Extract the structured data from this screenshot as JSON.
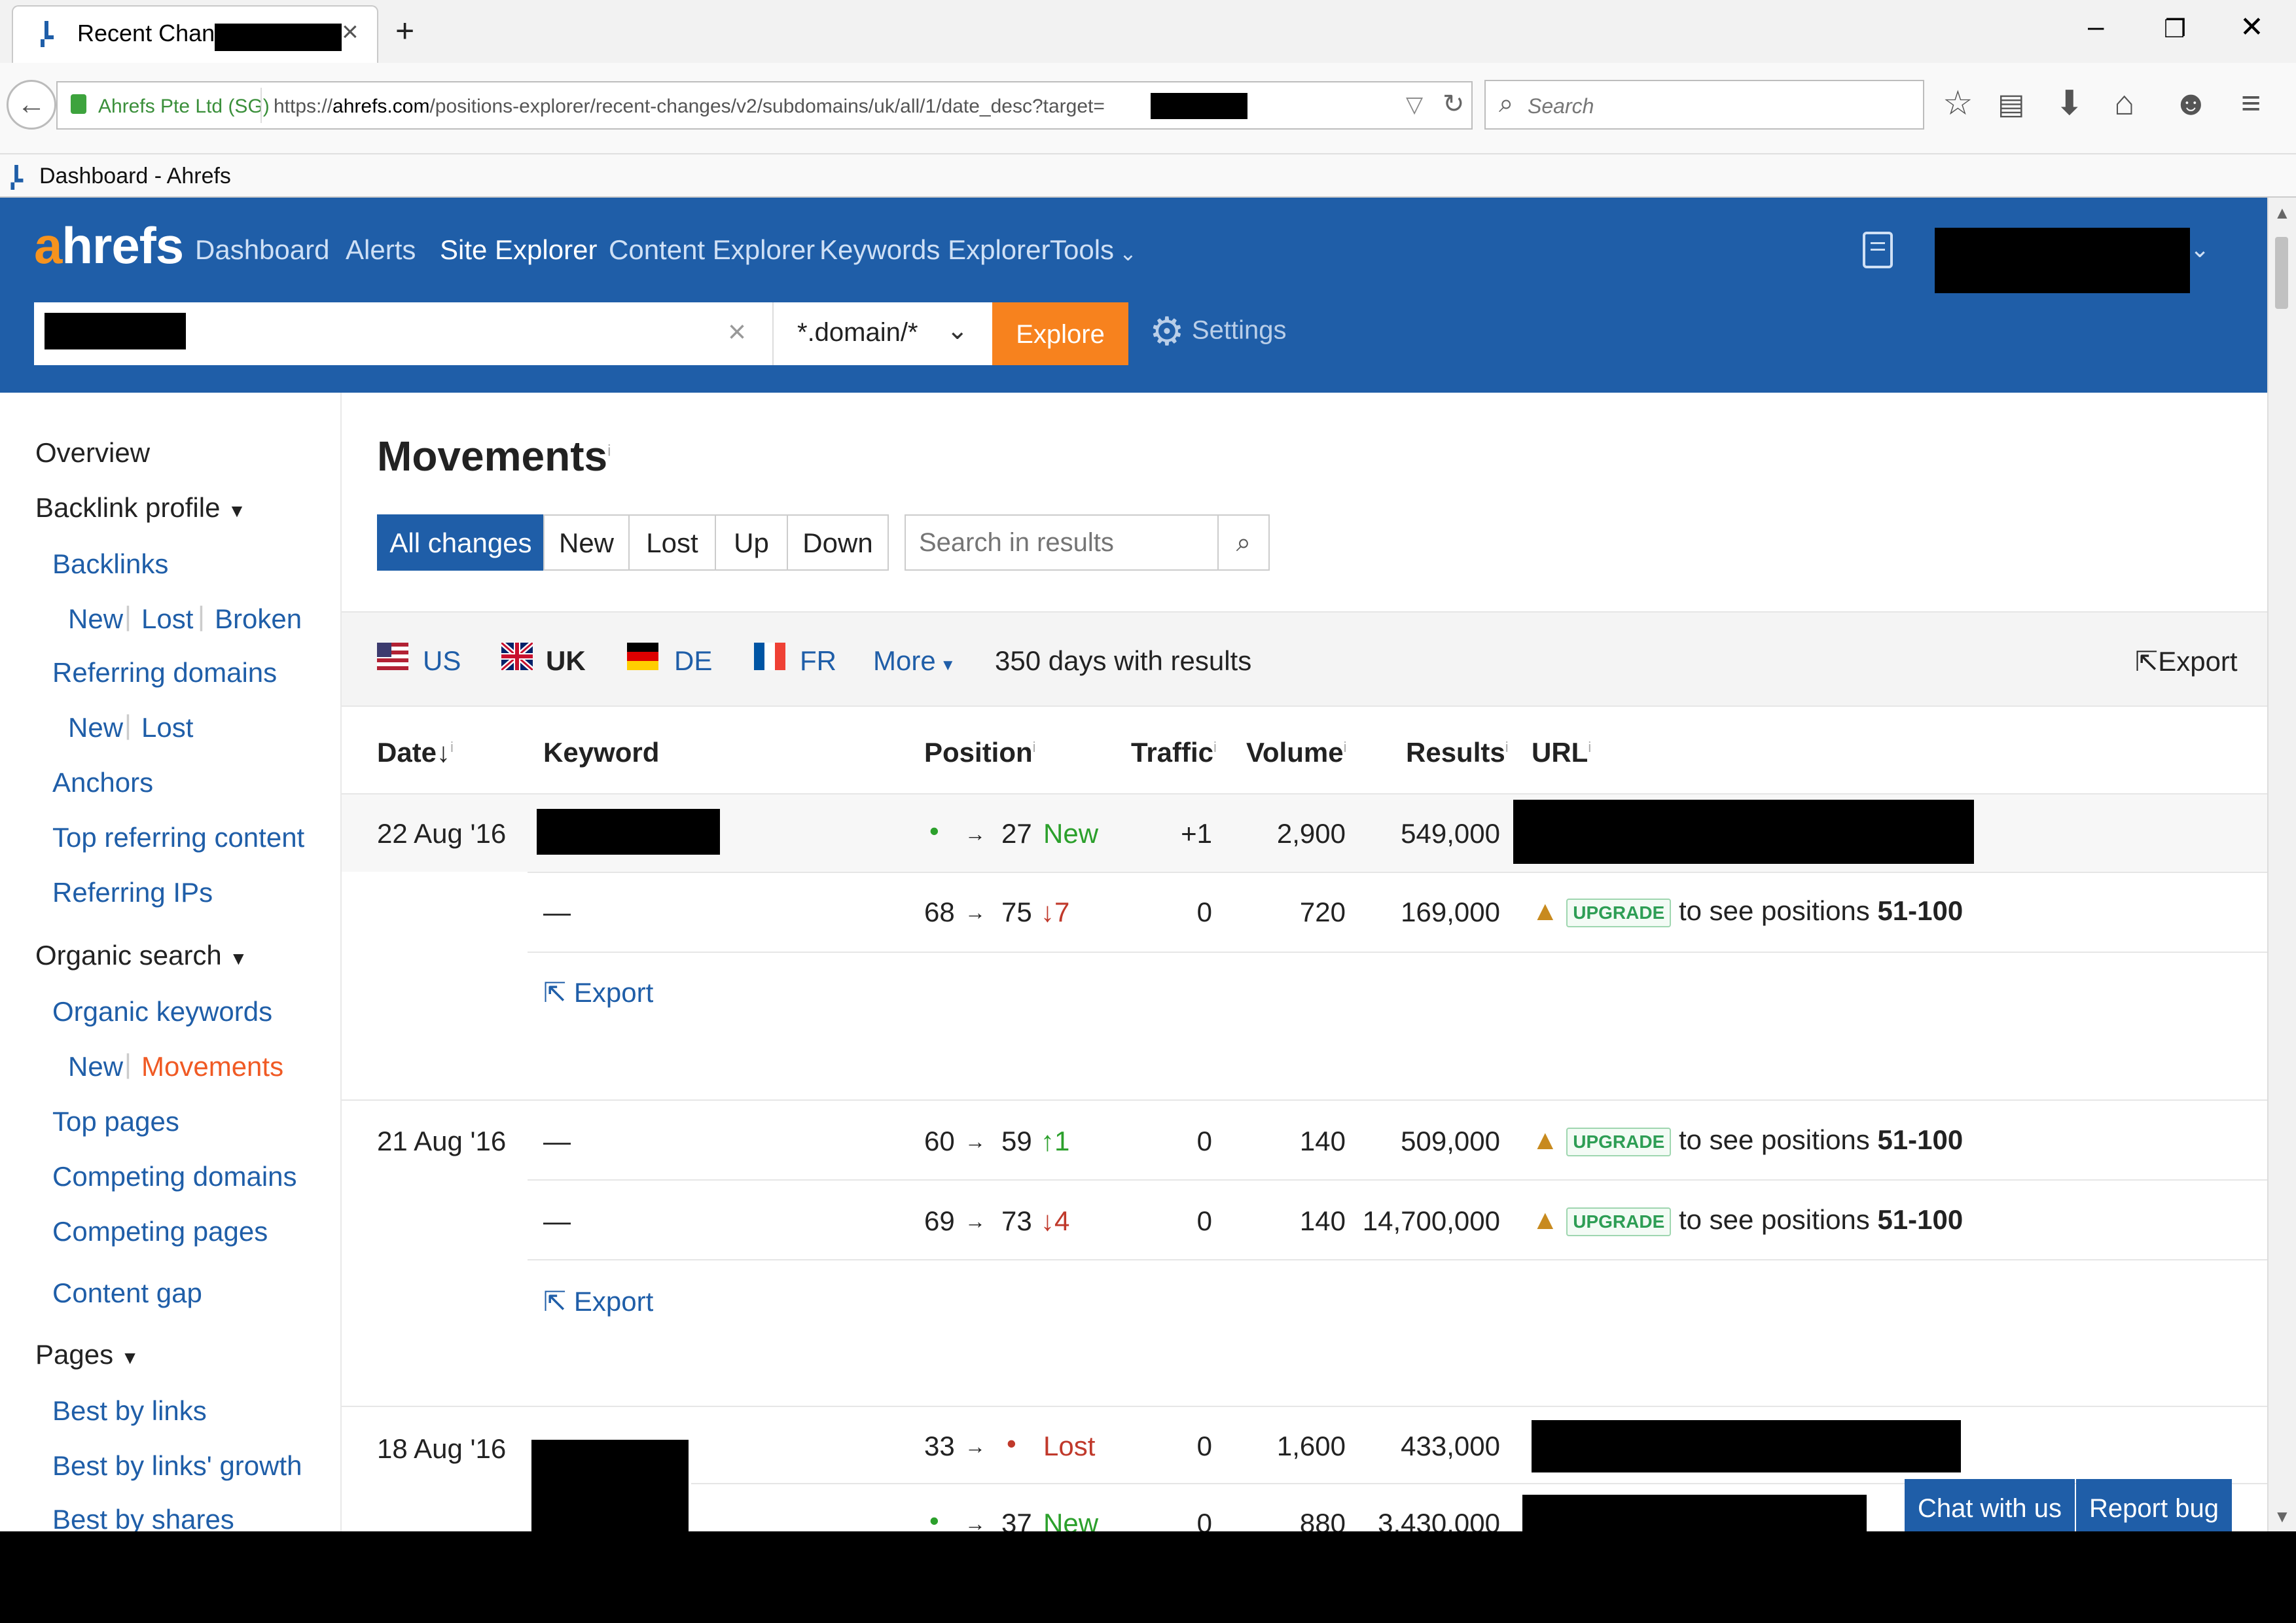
{
  "browser": {
    "tab_title": "Recent Changes",
    "window_controls": {
      "minimize": "–",
      "restore": "❐",
      "close": "✕"
    },
    "new_tab": "+",
    "site_identity": "Ahrefs Pte Ltd (SG)",
    "url_prefix": "https://",
    "url_host": "ahrefs.com",
    "url_path": "/positions-explorer/recent-changes/v2/subdomains/uk/all/1/date_desc?target=",
    "search_placeholder": "Search",
    "bookmark": "Dashboard - Ahrefs"
  },
  "header": {
    "logo_a": "a",
    "logo_rest": "hrefs",
    "nav": [
      "Dashboard",
      "Alerts",
      "Site Explorer",
      "Content Explorer",
      "Keywords Explorer",
      "Tools"
    ],
    "mode_value": "*.domain/*",
    "explore_label": "Explore",
    "settings_label": "Settings"
  },
  "sidebar": {
    "overview": "Overview",
    "backlink_profile": "Backlink profile",
    "backlinks": "Backlinks",
    "backlinks_sub": [
      "New",
      "Lost",
      "Broken"
    ],
    "referring_domains": "Referring domains",
    "referring_domains_sub": [
      "New",
      "Lost"
    ],
    "anchors": "Anchors",
    "top_referring_content": "Top referring content",
    "referring_ips": "Referring IPs",
    "organic_search": "Organic search",
    "organic_keywords": "Organic keywords",
    "organic_sub": [
      "New",
      "Movements"
    ],
    "top_pages": "Top pages",
    "competing_domains": "Competing domains",
    "competing_pages": "Competing pages",
    "content_gap": "Content gap",
    "pages": "Pages",
    "best_by_links": "Best by links",
    "best_by_links_growth": "Best by links' growth",
    "best_by_shares": "Best by shares"
  },
  "main": {
    "title": "Movements",
    "info": "i",
    "filters": [
      "All changes",
      "New",
      "Lost",
      "Up",
      "Down"
    ],
    "search_placeholder": "Search in results",
    "countries": [
      "US",
      "UK",
      "DE",
      "FR"
    ],
    "more": "More",
    "days": "350 days with results",
    "export": "Export",
    "columns": [
      "Date",
      "Keyword",
      "Position",
      "Traffic",
      "Volume",
      "Results",
      "URL"
    ],
    "upgrade": "UPGRADE",
    "upgrade_text": "to see positions ",
    "upgrade_range": "51-100",
    "groups": [
      {
        "date": "22 Aug '16",
        "rows": [
          {
            "keyword": "",
            "pos_from": "•",
            "pos_to": "27",
            "change": "New",
            "traffic": "+1",
            "volume": "2,900",
            "results": "549,000"
          },
          {
            "keyword": "—",
            "pos_from": "68",
            "pos_to": "75",
            "change": "↓7",
            "traffic": "0",
            "volume": "720",
            "results": "169,000"
          }
        ]
      },
      {
        "date": "21 Aug '16",
        "rows": [
          {
            "keyword": "—",
            "pos_from": "60",
            "pos_to": "59",
            "change": "↑1",
            "traffic": "0",
            "volume": "140",
            "results": "509,000"
          },
          {
            "keyword": "—",
            "pos_from": "69",
            "pos_to": "73",
            "change": "↓4",
            "traffic": "0",
            "volume": "140",
            "results": "14,700,000"
          }
        ]
      },
      {
        "date": "18 Aug '16",
        "rows": [
          {
            "keyword": "",
            "pos_from": "33",
            "pos_to": "•",
            "change": "Lost",
            "traffic": "0",
            "volume": "1,600",
            "results": "433,000"
          },
          {
            "keyword": "",
            "pos_from": "•",
            "pos_to": "37",
            "change": "New",
            "traffic": "0",
            "volume": "880",
            "results": "3,430,000"
          }
        ]
      }
    ]
  },
  "footer": {
    "chat": "Chat with us",
    "bug": "Report bug"
  }
}
